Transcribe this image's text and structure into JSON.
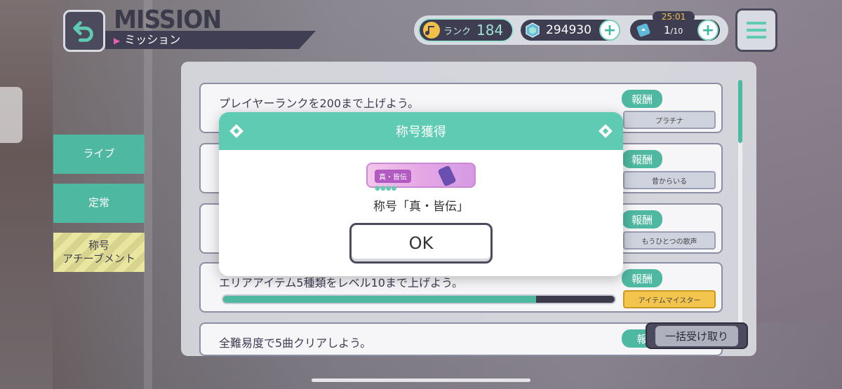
{
  "header": {
    "title": "MISSION",
    "subtitle": "ミッション"
  },
  "status": {
    "rank_label": "ランク",
    "rank_value": "184",
    "coins": "294930",
    "energy_timer": "25:01",
    "energy_current": "1",
    "energy_max": "/10"
  },
  "tabs": [
    {
      "label": "ライブ"
    },
    {
      "label": "定常"
    },
    {
      "label_line1": "称号",
      "label_line2": "アチーブメント"
    }
  ],
  "missions": [
    {
      "text": "プレイヤーランクを200まで上げよう。",
      "reward_label": "報酬",
      "reward_item": "プラチナ"
    },
    {
      "text": "",
      "reward_label": "報酬",
      "reward_item": "昔からいる"
    },
    {
      "text": "",
      "reward_label": "報酬",
      "reward_item": "もうひとつの歌声"
    },
    {
      "text": "エリアアイテム5種類をレベル10まで上げよう。",
      "reward_label": "報酬",
      "reward_item": "アイテムマイスター",
      "progress": 0.8
    },
    {
      "text": "全難易度で5曲クリアしよう。",
      "reward_label": "報"
    }
  ],
  "claim_all": "一括受け取り",
  "modal": {
    "title": "称号獲得",
    "badge_label": "真・皆伝",
    "message": "称号「真・皆伝」",
    "ok_label": "OK"
  },
  "colors": {
    "accent": "#5fcbb2",
    "dark": "#3e3d51",
    "pink": "#e85fb3"
  }
}
